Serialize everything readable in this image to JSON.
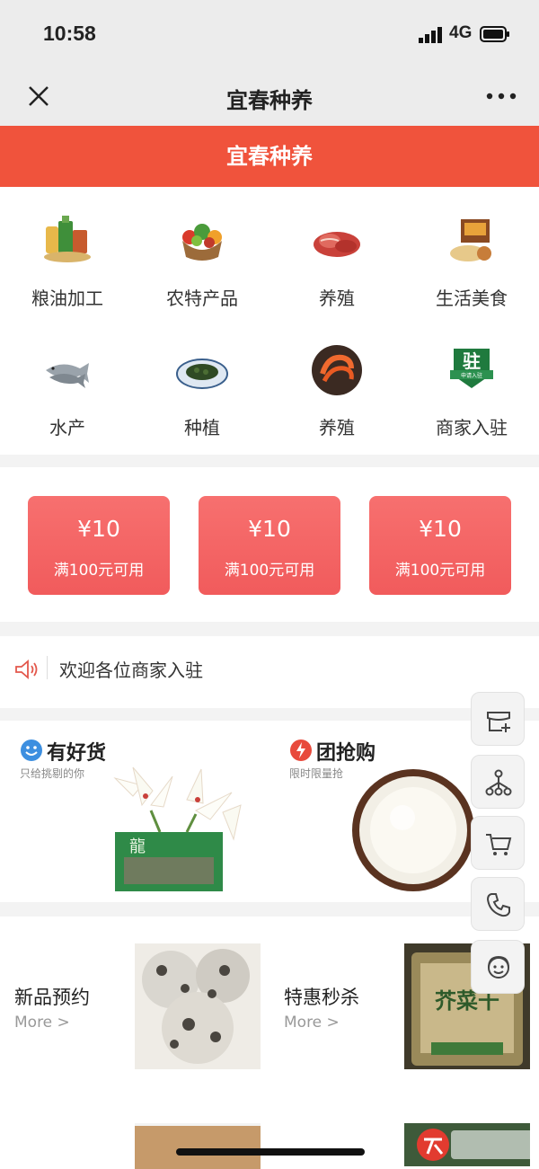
{
  "status_bar": {
    "time": "10:58",
    "network": "4G"
  },
  "nav": {
    "title": "宜春种养"
  },
  "banner": {
    "title": "宜春种养"
  },
  "categories": [
    {
      "label": "粮油加工",
      "icon": "grain-oil-icon"
    },
    {
      "label": "农特产品",
      "icon": "vegetable-basket-icon"
    },
    {
      "label": "养殖",
      "icon": "meat-icon"
    },
    {
      "label": "生活美食",
      "icon": "food-box-icon"
    },
    {
      "label": "水产",
      "icon": "fish-icon"
    },
    {
      "label": "种植",
      "icon": "tea-bowl-icon"
    },
    {
      "label": "养殖",
      "icon": "shrimp-icon"
    },
    {
      "label": "商家入驻",
      "icon": "merchant-badge-icon",
      "badge_text": "驻",
      "badge_sub": "申请入驻"
    }
  ],
  "coupons": [
    {
      "amount": "¥10",
      "condition": "满100元可用"
    },
    {
      "amount": "¥10",
      "condition": "满100元可用"
    },
    {
      "amount": "¥10",
      "condition": "满100元可用"
    }
  ],
  "notice": {
    "text": "欢迎各位商家入驻",
    "icon": "speaker-icon"
  },
  "promos": [
    {
      "title": "有好货",
      "subtitle": "只给挑剔的你",
      "icon": "smile-icon",
      "image": "lily-gift-box",
      "box_text": "龍"
    },
    {
      "title": "团抢购",
      "subtitle": "限时限量抢",
      "icon": "lightning-icon",
      "image": "rice-bowl"
    }
  ],
  "product_sections": [
    {
      "title": "新品预约",
      "more": "More >",
      "image": "mushroom"
    },
    {
      "title": "特惠秒杀",
      "more": "More >",
      "image": "dried-vegetable-bag",
      "bag_text": "芥菜干"
    }
  ],
  "floating_buttons": [
    {
      "name": "store-icon"
    },
    {
      "name": "share-tree-icon"
    },
    {
      "name": "cart-icon"
    },
    {
      "name": "phone-icon"
    },
    {
      "name": "customer-service-icon"
    }
  ],
  "colors": {
    "brand": "#f0533c",
    "coupon": "#f36464",
    "background": "#f3f3f3"
  }
}
